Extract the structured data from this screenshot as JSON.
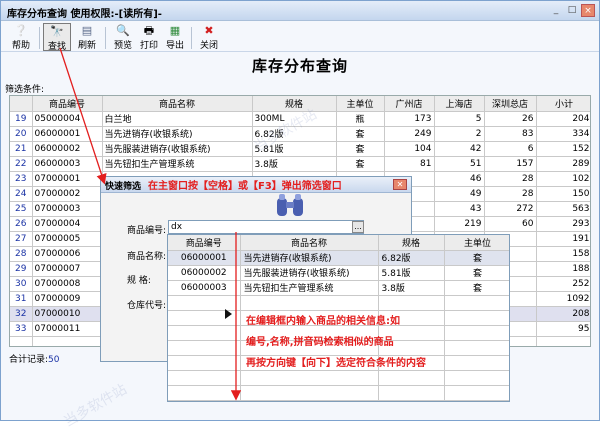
{
  "window": {
    "title": "库存分布查询  使用权限:-[读所有]-",
    "controls": [
      "_",
      "□",
      "×"
    ]
  },
  "toolbar": [
    {
      "label": "帮助",
      "icon": "help-icon",
      "glyph": "❔"
    },
    {
      "label": "查找",
      "icon": "binoculars-icon",
      "glyph": "🔭"
    },
    {
      "label": "刷新",
      "icon": "refresh-icon",
      "glyph": "▤"
    },
    {
      "label": "预览",
      "icon": "preview-icon",
      "glyph": "🔍"
    },
    {
      "label": "打印",
      "icon": "print-icon",
      "glyph": "🖶"
    },
    {
      "label": "导出",
      "icon": "export-icon",
      "glyph": "▦"
    },
    {
      "label": "关闭",
      "icon": "close-icon",
      "glyph": "✖"
    }
  ],
  "heading": "库存分布查询",
  "filter_label": "筛选条件:",
  "grid": {
    "columns": [
      "",
      "商品编号",
      "商品名称",
      "规格",
      "主单位",
      "广州店",
      "上海店",
      "深圳总店",
      "小计"
    ],
    "rows": [
      [
        "19",
        "05000004",
        "白兰地",
        "300ML",
        "瓶",
        "173",
        "5",
        "26",
        "204"
      ],
      [
        "20",
        "06000001",
        "当先进销存(收银系统)",
        "6.82版",
        "套",
        "249",
        "2",
        "83",
        "334"
      ],
      [
        "21",
        "06000002",
        "当先服装进销存(收银系统)",
        "5.81版",
        "套",
        "104",
        "42",
        "6",
        "152"
      ],
      [
        "22",
        "06000003",
        "当先钮扣生产管理系统",
        "3.8版",
        "套",
        "81",
        "51",
        "157",
        "289"
      ],
      [
        "23",
        "07000001",
        "",
        "",
        "",
        "",
        "46",
        "28",
        "102"
      ],
      [
        "24",
        "07000002",
        "",
        "",
        "",
        "",
        "49",
        "28",
        "150"
      ],
      [
        "25",
        "07000003",
        "",
        "",
        "",
        "",
        "43",
        "272",
        "563"
      ],
      [
        "26",
        "07000004",
        "",
        "",
        "",
        "",
        "219",
        "60",
        "293"
      ],
      [
        "27",
        "07000005",
        "",
        "",
        "",
        "",
        "",
        "",
        "191"
      ],
      [
        "28",
        "07000006",
        "",
        "",
        "",
        "",
        "",
        "",
        "158"
      ],
      [
        "29",
        "07000007",
        "",
        "",
        "",
        "",
        "",
        "",
        "188"
      ],
      [
        "30",
        "07000008",
        "",
        "",
        "",
        "",
        "",
        "",
        "252"
      ],
      [
        "31",
        "07000009",
        "",
        "",
        "",
        "",
        "",
        "",
        "1092"
      ],
      [
        "32",
        "07000010",
        "",
        "",
        "",
        "",
        "",
        "",
        "208"
      ],
      [
        "33",
        "07000011",
        "",
        "",
        "",
        "",
        "",
        "",
        "95"
      ],
      [
        "",
        "",
        "",
        "",
        "",
        "",
        "",
        "",
        ""
      ]
    ],
    "highlight_row": 13
  },
  "status": {
    "label": "合计记录:",
    "value": "50"
  },
  "dialog": {
    "title": "快速筛选",
    "annotation": "在主窗口按【空格】或【F3】弹出筛选窗口",
    "fields": {
      "code_label": "商品编号:",
      "code_value": "dx",
      "name_label": "商品名称:",
      "spec_label": "规  格:",
      "warehouse_label": "仓库代号:"
    },
    "ellipsis": "..."
  },
  "dropdown": {
    "columns": [
      "商品编号",
      "商品名称",
      "规格",
      "主单位"
    ],
    "rows": [
      [
        "06000001",
        "当先进销存(收银系统)",
        "6.82版",
        "套"
      ],
      [
        "06000002",
        "当先服装进销存(收银系统)",
        "5.81版",
        "套"
      ],
      [
        "06000003",
        "当先钮扣生产管理系统",
        "3.8版",
        "套"
      ]
    ],
    "selected_row": 0
  },
  "annotation2": [
    "在编辑框内输入商品的相关信息:如",
    "编号,名称,拼音码检索相似的商品",
    "再按方向键【向下】选定符合条件的内容"
  ],
  "colors": {
    "annotation": "#e31e1e",
    "rownum": "#1b33a5",
    "frame": "#7da2ce"
  },
  "watermark": "当多软件站"
}
